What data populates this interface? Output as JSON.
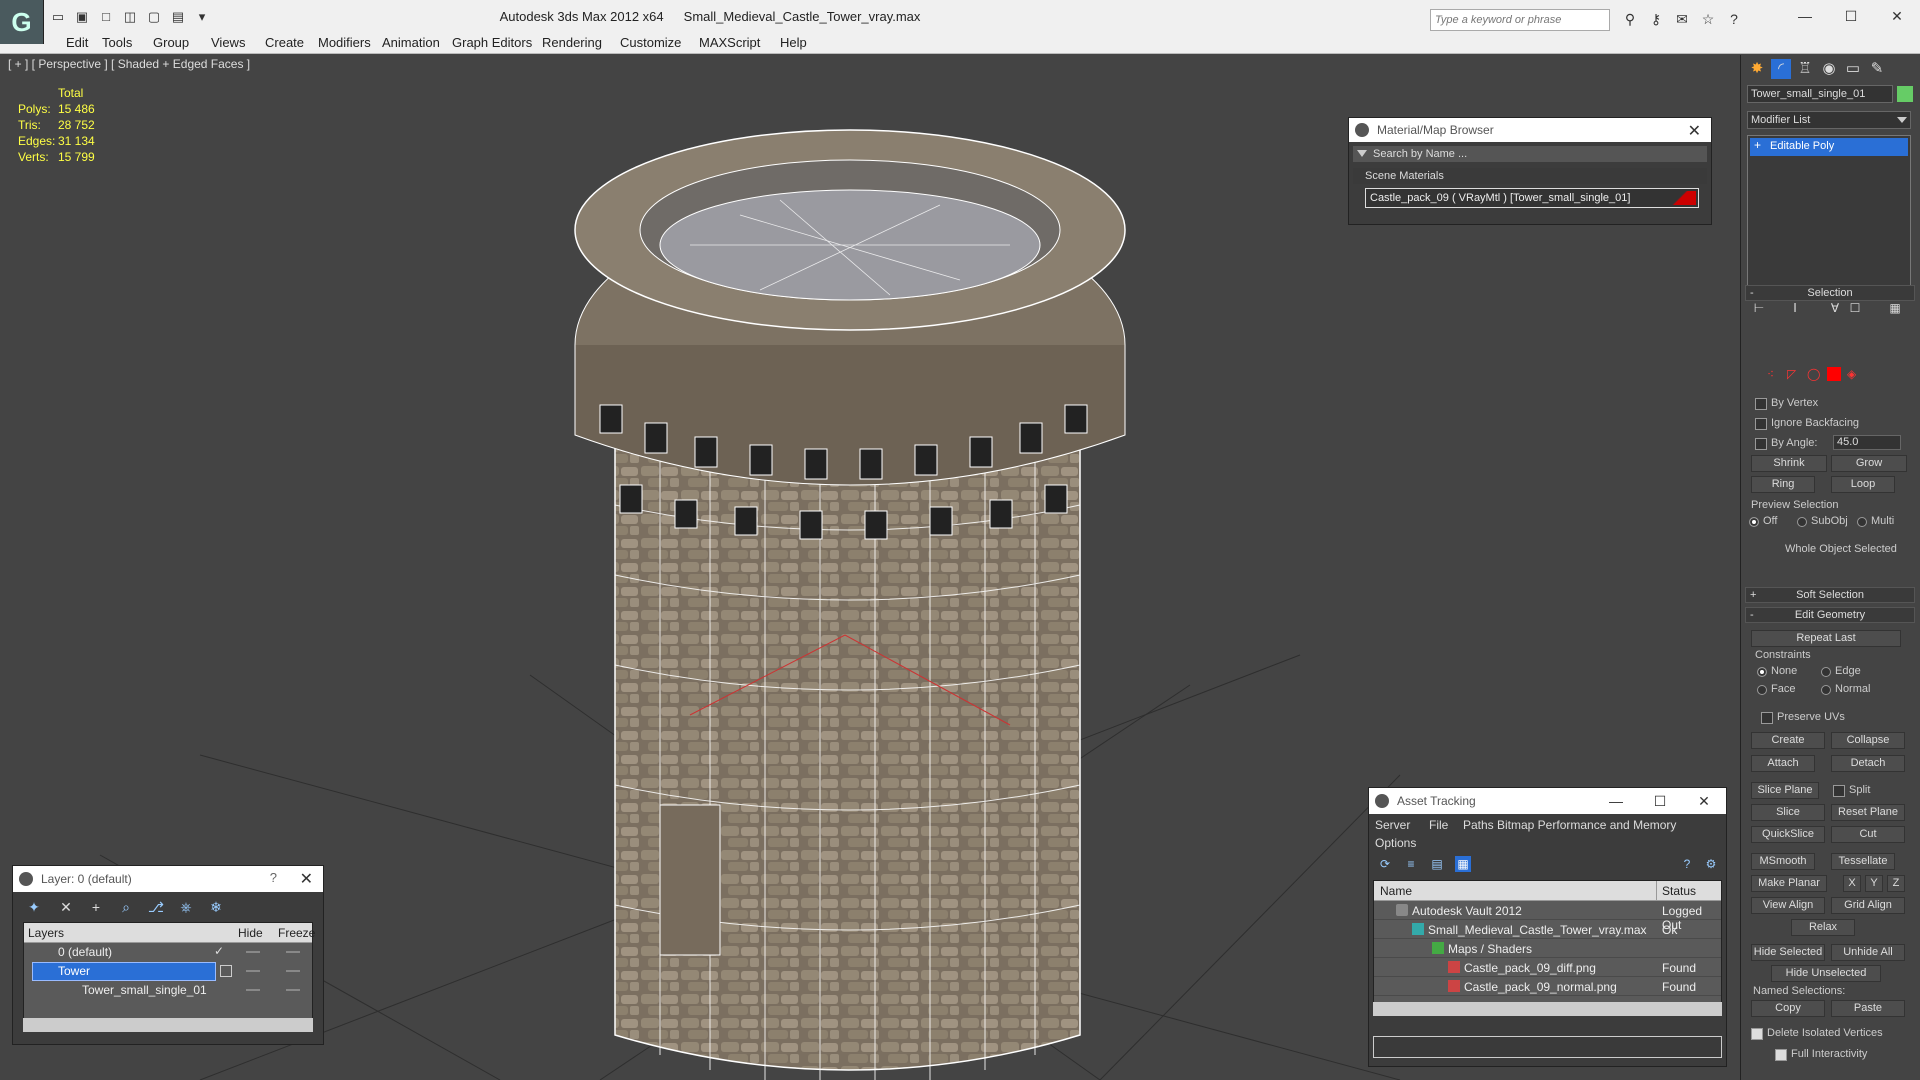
{
  "app": {
    "title": "Autodesk 3ds Max  2012 x64",
    "file": "Small_Medieval_Castle_Tower_vray.max",
    "search_placeholder": "Type a keyword or phrase"
  },
  "menu": [
    "Edit",
    "Tools",
    "Group",
    "Views",
    "Create",
    "Modifiers",
    "Animation",
    "Graph Editors",
    "Rendering",
    "Customize",
    "MAXScript",
    "Help"
  ],
  "viewport": {
    "label": "[ + ] [ Perspective ] [ Shaded + Edged Faces ]",
    "stats_header": "Total",
    "stats": [
      {
        "k": "Polys:",
        "v": "15 486"
      },
      {
        "k": "Tris:",
        "v": "28 752"
      },
      {
        "k": "Edges:",
        "v": "31 134"
      },
      {
        "k": "Verts:",
        "v": "15 799"
      }
    ]
  },
  "material_browser": {
    "title": "Material/Map Browser",
    "search": "Search by Name ...",
    "section": "Scene Materials",
    "item": "Castle_pack_09  ( VRayMtl )  [Tower_small_single_01]"
  },
  "asset_tracking": {
    "title": "Asset Tracking",
    "menu": [
      "Server",
      "File",
      "Paths",
      "Bitmap Performance and Memory",
      "Options"
    ],
    "col_name": "Name",
    "col_status": "Status",
    "rows": [
      {
        "name": "Autodesk Vault 2012",
        "status": "Logged Out"
      },
      {
        "name": "Small_Medieval_Castle_Tower_vray.max",
        "status": "Ok"
      },
      {
        "name": "Maps / Shaders",
        "status": ""
      },
      {
        "name": "Castle_pack_09_diff.png",
        "status": "Found"
      },
      {
        "name": "Castle_pack_09_normal.png",
        "status": "Found"
      }
    ]
  },
  "layer_manager": {
    "title": "Layer: 0 (default)",
    "help": "?",
    "col_layers": "Layers",
    "col_hide": "Hide",
    "col_freeze": "Freeze",
    "rows": [
      {
        "name": "0 (default)"
      },
      {
        "name": "Tower"
      },
      {
        "name": "Tower_small_single_01"
      }
    ]
  },
  "command_panel": {
    "object_name": "Tower_small_single_01",
    "modifier_list": "Modifier List",
    "stack_item": "Editable Poly",
    "selection": {
      "title": "Selection",
      "by_vertex": "By Vertex",
      "ignore_backfacing": "Ignore Backfacing",
      "by_angle": "By Angle:",
      "angle_value": "45.0",
      "shrink": "Shrink",
      "grow": "Grow",
      "ring": "Ring",
      "loop": "Loop",
      "preview": "Preview Selection",
      "off": "Off",
      "subobj": "SubObj",
      "multi": "Multi",
      "status": "Whole Object Selected"
    },
    "soft_selection": "Soft Selection",
    "edit_geometry": {
      "title": "Edit Geometry",
      "repeat_last": "Repeat Last",
      "constraints": "Constraints",
      "none": "None",
      "edge": "Edge",
      "face": "Face",
      "normal": "Normal",
      "preserve_uvs": "Preserve UVs",
      "create": "Create",
      "collapse": "Collapse",
      "attach": "Attach",
      "detach": "Detach",
      "slice_plane": "Slice Plane",
      "split": "Split",
      "slice": "Slice",
      "reset_plane": "Reset Plane",
      "quickslice": "QuickSlice",
      "cut": "Cut",
      "msmooth": "MSmooth",
      "tessellate": "Tessellate",
      "make_planar": "Make Planar",
      "x": "X",
      "y": "Y",
      "z": "Z",
      "view_align": "View Align",
      "grid_align": "Grid Align",
      "relax": "Relax",
      "hide_selected": "Hide Selected",
      "unhide_all": "Unhide All",
      "hide_unselected": "Hide Unselected",
      "named_selections": "Named Selections:",
      "copy": "Copy",
      "paste": "Paste",
      "delete_isolated": "Delete Isolated Vertices",
      "full_interactivity": "Full Interactivity"
    }
  }
}
